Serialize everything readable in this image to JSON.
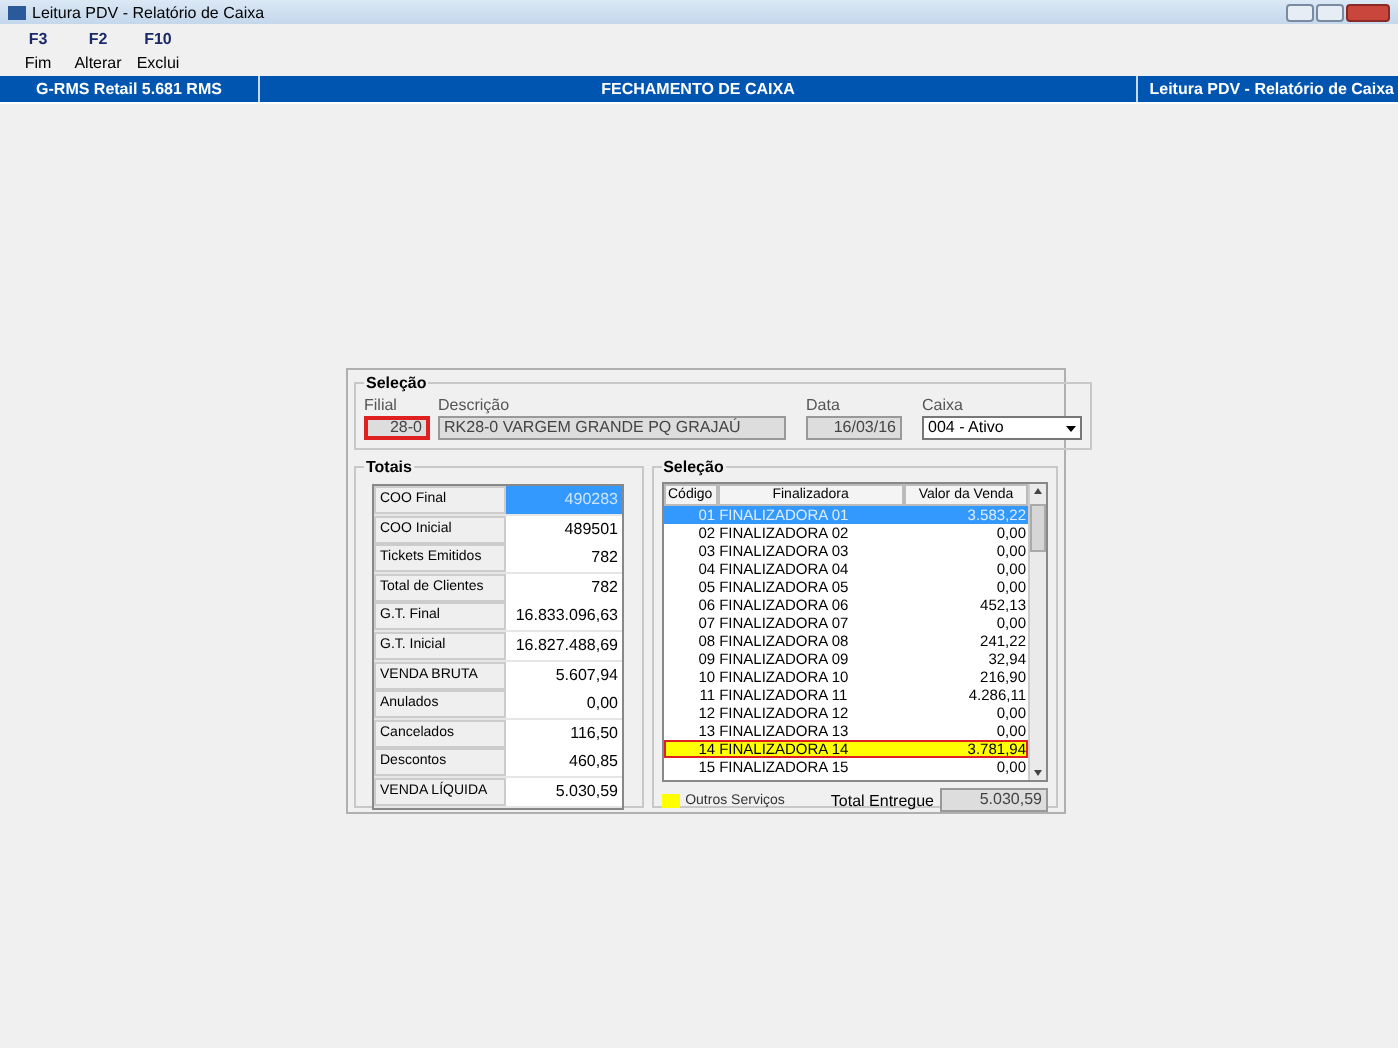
{
  "window": {
    "title": "Leitura PDV - Relatório de Caixa"
  },
  "toolbar": [
    {
      "key": "F3",
      "label": "Fim"
    },
    {
      "key": "F2",
      "label": "Alterar"
    },
    {
      "key": "F10",
      "label": "Exclui"
    }
  ],
  "header_bar": {
    "left": "G-RMS Retail 5.681 RMS",
    "center": "FECHAMENTO DE CAIXA",
    "right": "Leitura PDV - Relatório de Caixa"
  },
  "selection_group": {
    "title": "Seleção",
    "filial": {
      "label": "Filial",
      "value": "28-0",
      "outlined": true
    },
    "descricao": {
      "label": "Descrição",
      "value": "RK28-0 VARGEM GRANDE PQ GRAJAÚ"
    },
    "data": {
      "label": "Data",
      "value": "16/03/16"
    },
    "caixa": {
      "label": "Caixa",
      "value": "004 - Ativo"
    }
  },
  "totals": {
    "title": "Totais",
    "rows": [
      {
        "label": "COO Final",
        "value": "490283",
        "selected": true
      },
      {
        "label": "COO Inicial",
        "value": "489501",
        "selected": false
      },
      {
        "label": "Tickets Emitidos",
        "value": "782",
        "selected": false
      },
      {
        "label": "Total de Clientes",
        "value": "782",
        "selected": false
      },
      {
        "label": "G.T. Final",
        "value": "16.833.096,63",
        "selected": false
      },
      {
        "label": "G.T. Inicial",
        "value": "16.827.488,69",
        "selected": false
      },
      {
        "label": "VENDA BRUTA",
        "value": "5.607,94",
        "selected": false
      },
      {
        "label": "Anulados",
        "value": "0,00",
        "selected": false
      },
      {
        "label": "Cancelados",
        "value": "116,50",
        "selected": false
      },
      {
        "label": "Descontos",
        "value": "460,85",
        "selected": false
      },
      {
        "label": "VENDA LÍQUIDA",
        "value": "5.030,59",
        "selected": false
      }
    ]
  },
  "finalizadoras": {
    "title": "Seleção",
    "columns": [
      "Código",
      "Finalizadora",
      "Valor da Venda"
    ],
    "rows": [
      {
        "code": "01",
        "name": "FINALIZADORA 01",
        "value": "3.583,22",
        "selected": true,
        "highlighted": false
      },
      {
        "code": "02",
        "name": "FINALIZADORA 02",
        "value": "0,00",
        "selected": false,
        "highlighted": false
      },
      {
        "code": "03",
        "name": "FINALIZADORA 03",
        "value": "0,00",
        "selected": false,
        "highlighted": false
      },
      {
        "code": "04",
        "name": "FINALIZADORA 04",
        "value": "0,00",
        "selected": false,
        "highlighted": false
      },
      {
        "code": "05",
        "name": "FINALIZADORA 05",
        "value": "0,00",
        "selected": false,
        "highlighted": false
      },
      {
        "code": "06",
        "name": "FINALIZADORA 06",
        "value": "452,13",
        "selected": false,
        "highlighted": false
      },
      {
        "code": "07",
        "name": "FINALIZADORA 07",
        "value": "0,00",
        "selected": false,
        "highlighted": false
      },
      {
        "code": "08",
        "name": "FINALIZADORA 08",
        "value": "241,22",
        "selected": false,
        "highlighted": false
      },
      {
        "code": "09",
        "name": "FINALIZADORA 09",
        "value": "32,94",
        "selected": false,
        "highlighted": false
      },
      {
        "code": "10",
        "name": "FINALIZADORA 10",
        "value": "216,90",
        "selected": false,
        "highlighted": false
      },
      {
        "code": "11",
        "name": "FINALIZADORA 11",
        "value": "4.286,11",
        "selected": false,
        "highlighted": false
      },
      {
        "code": "12",
        "name": "FINALIZADORA 12",
        "value": "0,00",
        "selected": false,
        "highlighted": false
      },
      {
        "code": "13",
        "name": "FINALIZADORA 13",
        "value": "0,00",
        "selected": false,
        "highlighted": false
      },
      {
        "code": "14",
        "name": "FINALIZADORA 14",
        "value": "3.781,94",
        "selected": false,
        "highlighted": true
      },
      {
        "code": "15",
        "name": "FINALIZADORA 15",
        "value": "0,00",
        "selected": false,
        "highlighted": false
      }
    ],
    "legend": {
      "label": "Outros Serviços",
      "color": "#ffff00"
    },
    "total": {
      "label": "Total Entregue",
      "value": "5.030,59"
    }
  }
}
